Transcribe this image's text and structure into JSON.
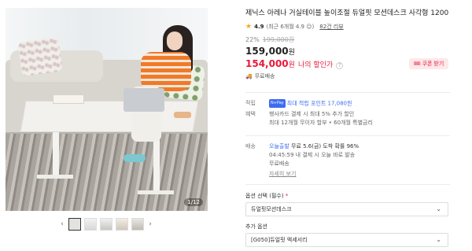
{
  "gallery": {
    "counter": "1/12",
    "prev_arrow": "‹",
    "next_arrow": "›"
  },
  "product": {
    "title": "제닉스 아레나 거실테이블 높이조절 듀얼핏 모션데스크 사각형 1200",
    "rating": {
      "score": "4.9",
      "summary": "(최근 6개월 4.9 ☺)",
      "reviews_link": "82건 리뷰"
    },
    "discount_rate": "22%",
    "original_price": "199,000원",
    "price": "159,000",
    "price_unit": "원",
    "my_price": "154,000",
    "my_price_unit": "원",
    "my_price_label": "나의 할인가",
    "shipping_free": "무료배송",
    "coupon_label": "쿠폰 받기"
  },
  "benefits": {
    "points_key": "적립",
    "points_badge": "N+Pay",
    "points_text": "최대 적립 포인트 17,080원",
    "benefit_key": "혜택",
    "benefit_line1": "행사카드 결제 시 최대 5% 추가 할인",
    "benefit_line2": "최대 12개월 무이자 할부 • 60개월 특별금리"
  },
  "delivery": {
    "key": "배송",
    "line1_tag": "오늘출발",
    "line1_text": "무료 5.6(금) 도착 확률 96%",
    "line2": "04:45:59 내 결제 시 오늘 바로 발송",
    "line3": "무료배송",
    "detail_link": "자세히 보기"
  },
  "options": {
    "required_label": "옵션 선택 (필수)",
    "required_mark": "*",
    "required_value": "듀얼핏모션데스크",
    "extra_label": "추가 옵션",
    "extra_value": "[G050]듀얼핏 액세서리"
  },
  "colors": {
    "accent_red": "#e8183a",
    "naver_blue": "#3d6cf0",
    "star": "#f5a623"
  }
}
